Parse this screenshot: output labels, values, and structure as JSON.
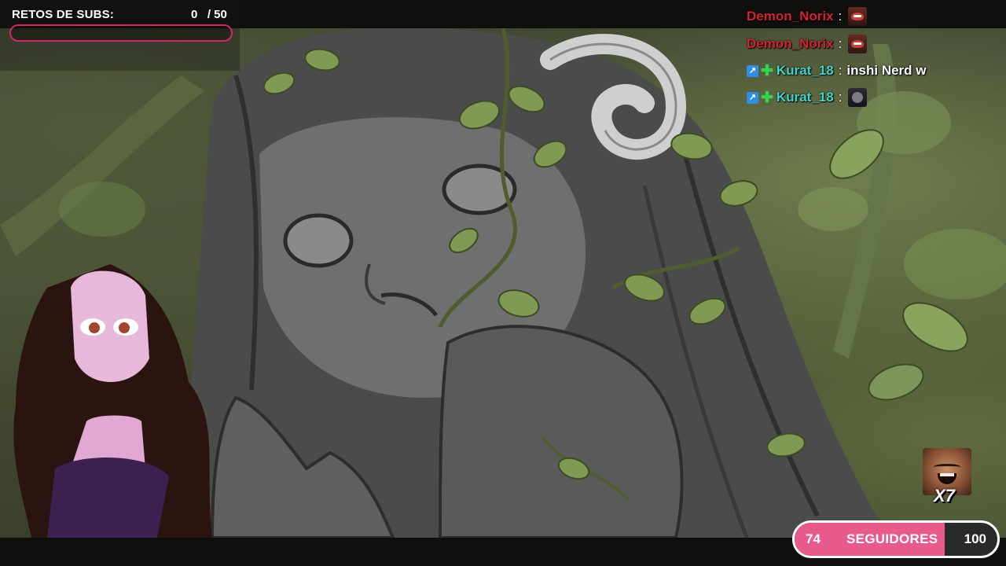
{
  "subs_goal": {
    "title": "RETOS DE SUBS:",
    "count_text": "0   / 50",
    "current": 0,
    "target": 50,
    "accent": "#d6246e"
  },
  "chat": {
    "messages": [
      {
        "user": "Demon_Norix",
        "user_color": "#d4232f",
        "separator": ":",
        "text": "",
        "emote": "pepe-rage-emote",
        "badges": []
      },
      {
        "user": "Demon_Norix",
        "user_color": "#d4232f",
        "separator": ":",
        "text": "",
        "emote": "pepe-rage-emote",
        "badges": []
      },
      {
        "user": "Kurat_18",
        "user_color": "#3fd6c8",
        "separator": ":",
        "text": "inshi Nerd w",
        "emote": "",
        "badges": [
          "arrow-badge-icon",
          "plus-badge-icon"
        ]
      },
      {
        "user": "Kurat_18",
        "user_color": "#3fd6c8",
        "separator": ":",
        "text": "",
        "emote": "dark-creature-emote",
        "badges": [
          "arrow-badge-icon",
          "plus-badge-icon"
        ]
      }
    ]
  },
  "emote_combo": {
    "emote": "laughing-man-emote",
    "count": "X7"
  },
  "followers_goal": {
    "current": "74",
    "label": "SEGUIDORES",
    "goal": "100",
    "progress_fraction": 0.74,
    "fill_color": "#e8598c"
  }
}
